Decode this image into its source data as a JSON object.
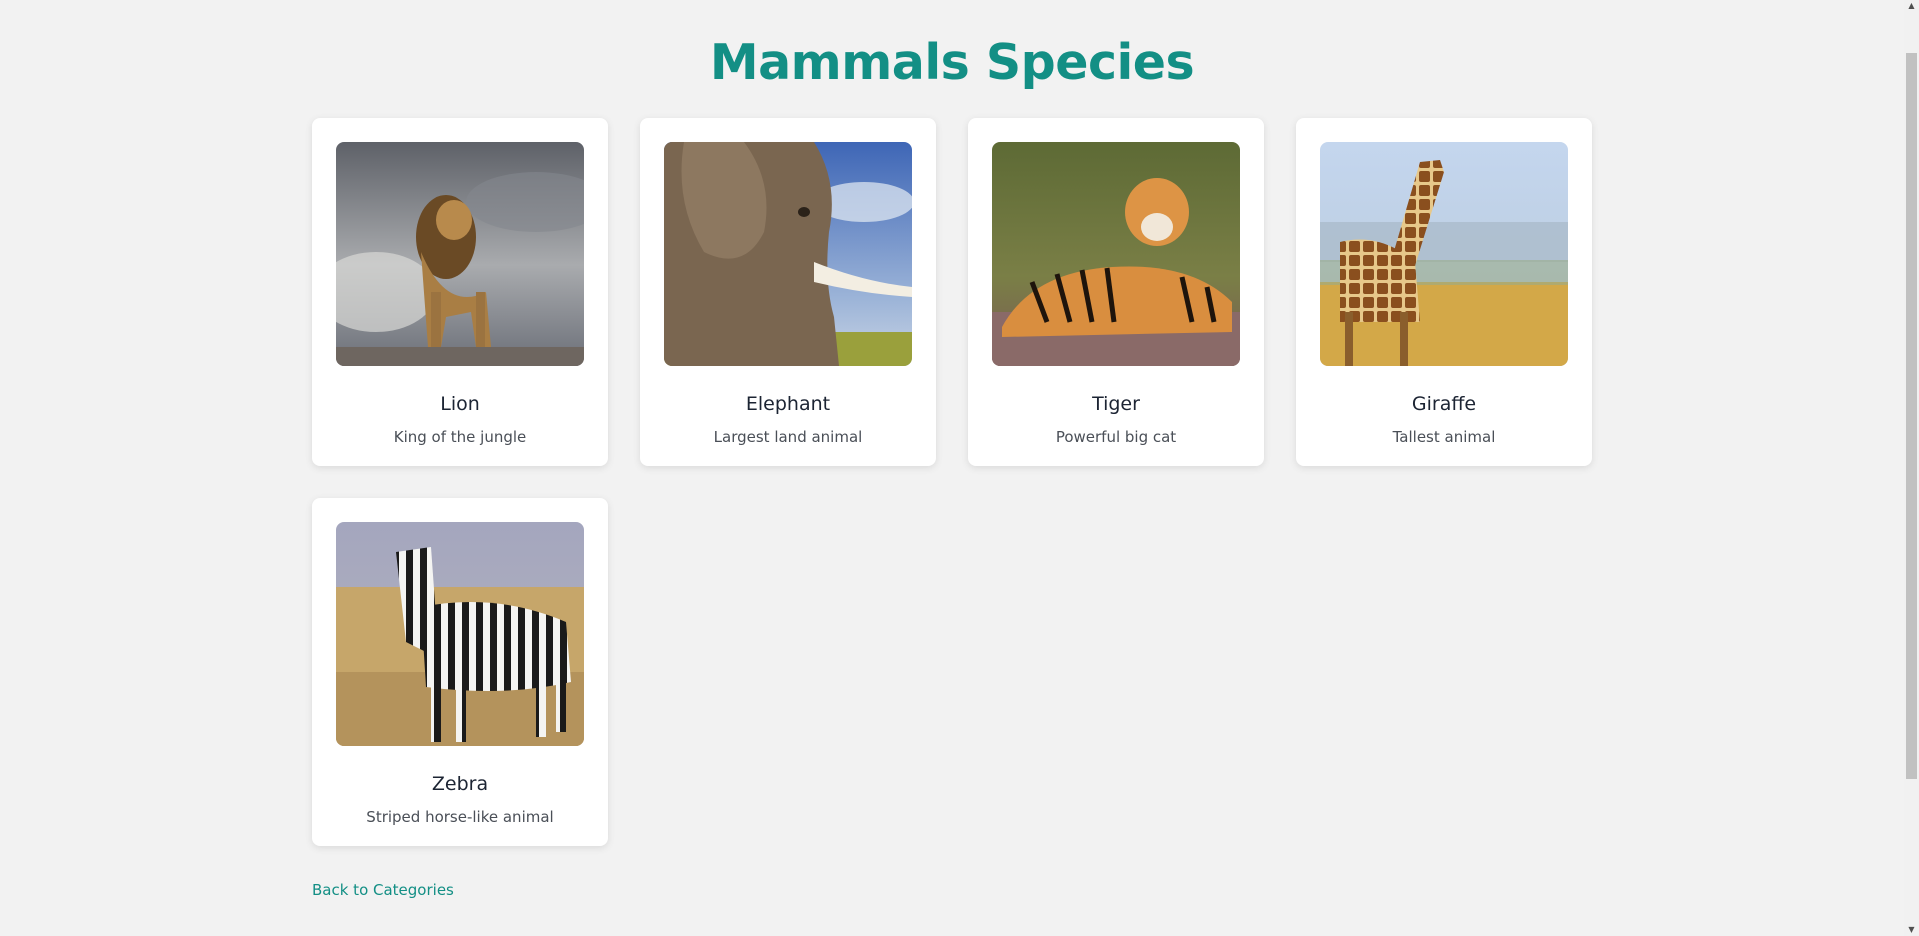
{
  "page": {
    "title": "Mammals Species",
    "accent_color": "#138f85"
  },
  "cards": [
    {
      "name": "Lion",
      "description": "King of the jungle",
      "image_icon": "lion-photo"
    },
    {
      "name": "Elephant",
      "description": "Largest land animal",
      "image_icon": "elephant-photo"
    },
    {
      "name": "Tiger",
      "description": "Powerful big cat",
      "image_icon": "tiger-photo"
    },
    {
      "name": "Giraffe",
      "description": "Tallest animal",
      "image_icon": "giraffe-photo"
    },
    {
      "name": "Zebra",
      "description": "Striped horse-like animal",
      "image_icon": "zebra-photo"
    }
  ],
  "footer": {
    "back_link": "Back to Categories"
  }
}
